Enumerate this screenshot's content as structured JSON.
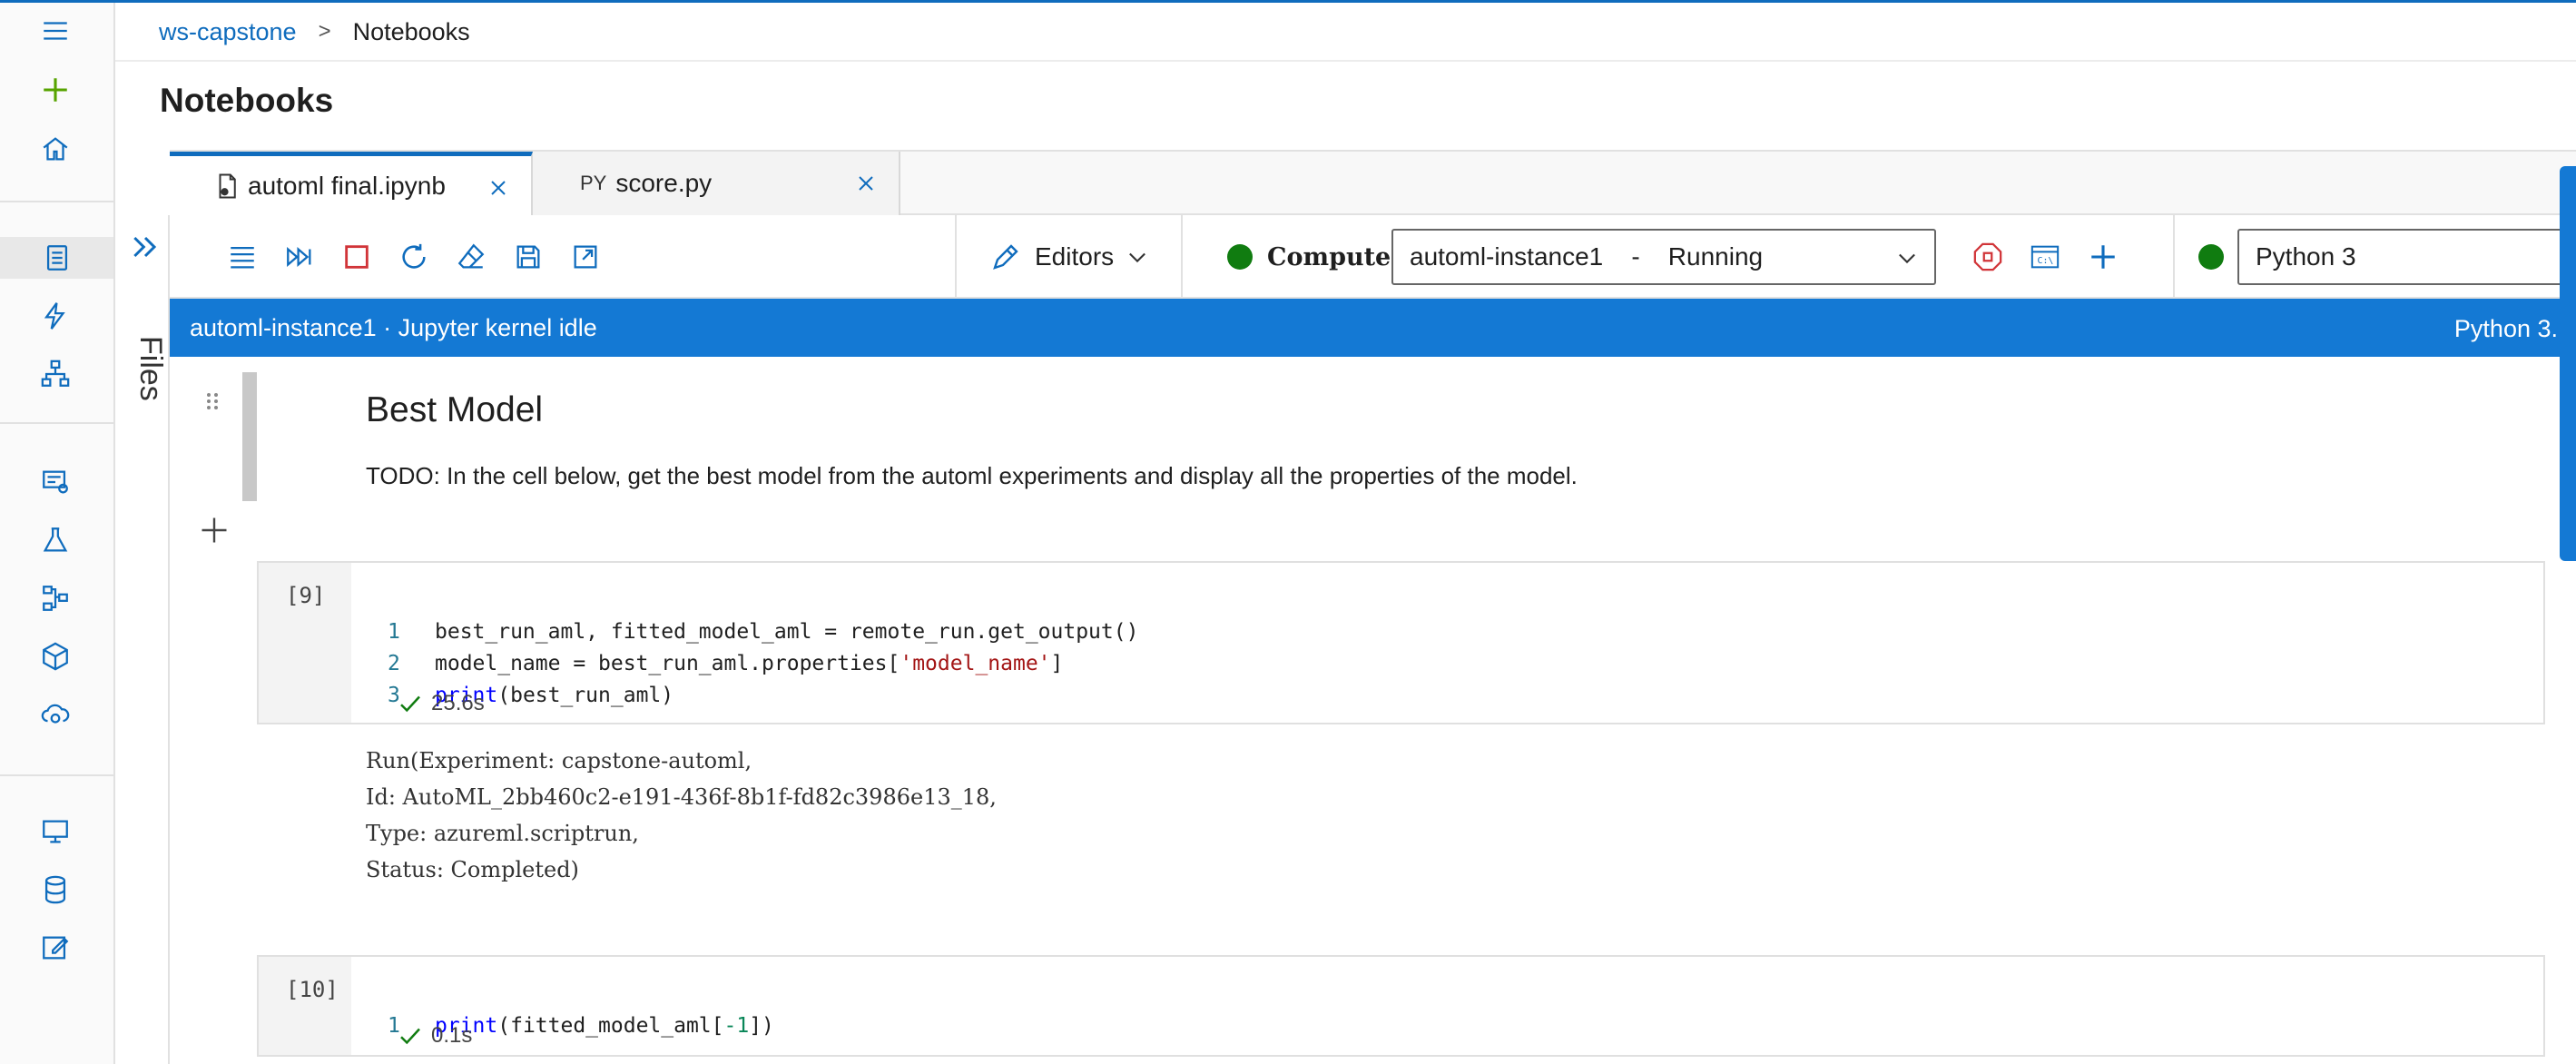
{
  "breadcrumb": {
    "workspace": "ws-capstone",
    "separator": ">",
    "current": "Notebooks"
  },
  "page": {
    "title": "Notebooks"
  },
  "files_panel": {
    "label": "Files"
  },
  "tabs": [
    {
      "label": "automl final.ipynb",
      "icon": "notebook-file-icon",
      "active": true
    },
    {
      "label": "score.py",
      "icon_text": "PY",
      "active": false
    }
  ],
  "toolbar": {
    "editors_label": "Editors",
    "compute_label": "Compute:",
    "compute_value": "automl-instance1    -    Running",
    "kernel_value": "Python 3"
  },
  "status": {
    "left": "automl-instance1 · Jupyter kernel idle",
    "right": "Python 3."
  },
  "markdown_cell": {
    "title": "Best Model",
    "text": "TODO: In the cell below, get the best model from the automl experiments and display all the properties of the model."
  },
  "cells": [
    {
      "exec_count": "[9]",
      "lines": [
        {
          "n": "1",
          "pre": "best_run_aml, fitted_model_aml = remote_run.get_output()"
        },
        {
          "n": "2",
          "pre": "model_name = best_run_aml.properties[",
          "str": "'model_name'",
          "post": "]"
        },
        {
          "n": "3",
          "kw": "print",
          "post": "(best_run_aml)"
        }
      ],
      "duration": "25.6s",
      "output": [
        "Run(Experiment: capstone-automl,",
        "Id: AutoML_2bb460c2-e191-436f-8b1f-fd82c3986e13_18,",
        "Type: azureml.scriptrun,",
        "Status: Completed)"
      ]
    },
    {
      "exec_count": "[10]",
      "lines": [
        {
          "n": "1",
          "kw": "print",
          "pre2": "(fitted_model_aml[",
          "num": "-1",
          "post": "])"
        }
      ],
      "duration": "0.1s"
    }
  ],
  "colors": {
    "accent": "#0f6cbd",
    "status_bar": "#1479d4",
    "running": "#107c10",
    "stop": "#d13438"
  }
}
